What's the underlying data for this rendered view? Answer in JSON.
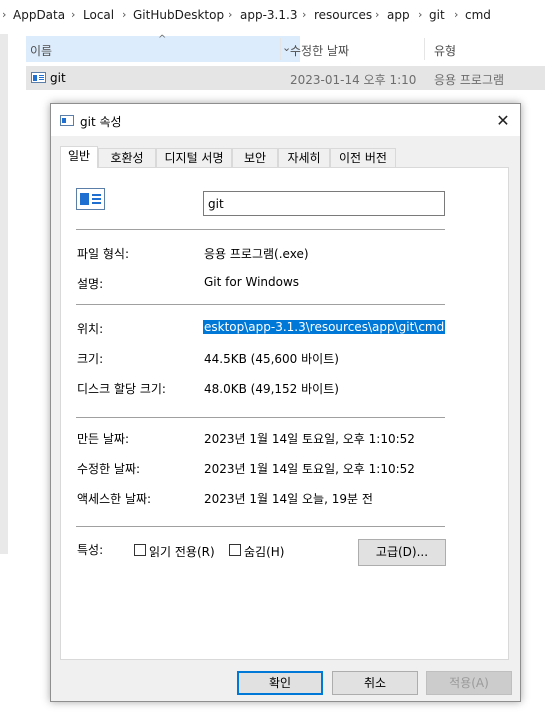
{
  "breadcrumb": [
    "AppData",
    "Local",
    "GitHubDesktop",
    "app-3.1.3",
    "resources",
    "app",
    "git",
    "cmd"
  ],
  "columns": {
    "name": "이름",
    "date": "수정한 날짜",
    "type": "유형"
  },
  "file": {
    "name": "git",
    "date": "2023-01-14 오후 1:10",
    "type": "응용 프로그램"
  },
  "dialog": {
    "title": "git 속성",
    "tabs": [
      "일반",
      "호환성",
      "디지털 서명",
      "보안",
      "자세히",
      "이전 버전"
    ],
    "filename": "git",
    "props": {
      "filetype_label": "파일 형식:",
      "filetype": "응용 프로그램(.exe)",
      "desc_label": "설명:",
      "desc": "Git for Windows",
      "location_label": "위치:",
      "location": "esktop\\app-3.1.3\\resources\\app\\git\\cmd",
      "size_label": "크기:",
      "size": "44.5KB (45,600 바이트)",
      "disksize_label": "디스크 할당 크기:",
      "disksize": "48.0KB (49,152 바이트)",
      "created_label": "만든 날짜:",
      "created": "2023년 1월 14일 토요일, 오후 1:10:52",
      "modified_label": "수정한 날짜:",
      "modified": "2023년 1월 14일 토요일, 오후 1:10:52",
      "accessed_label": "액세스한 날짜:",
      "accessed": "2023년 1월 14일 오늘, 19분 전",
      "attrs_label": "특성:",
      "readonly": "읽기 전용(R)",
      "hidden": "숨김(H)",
      "advanced": "고급(D)..."
    },
    "buttons": {
      "ok": "확인",
      "cancel": "취소",
      "apply": "적용(A)"
    }
  }
}
